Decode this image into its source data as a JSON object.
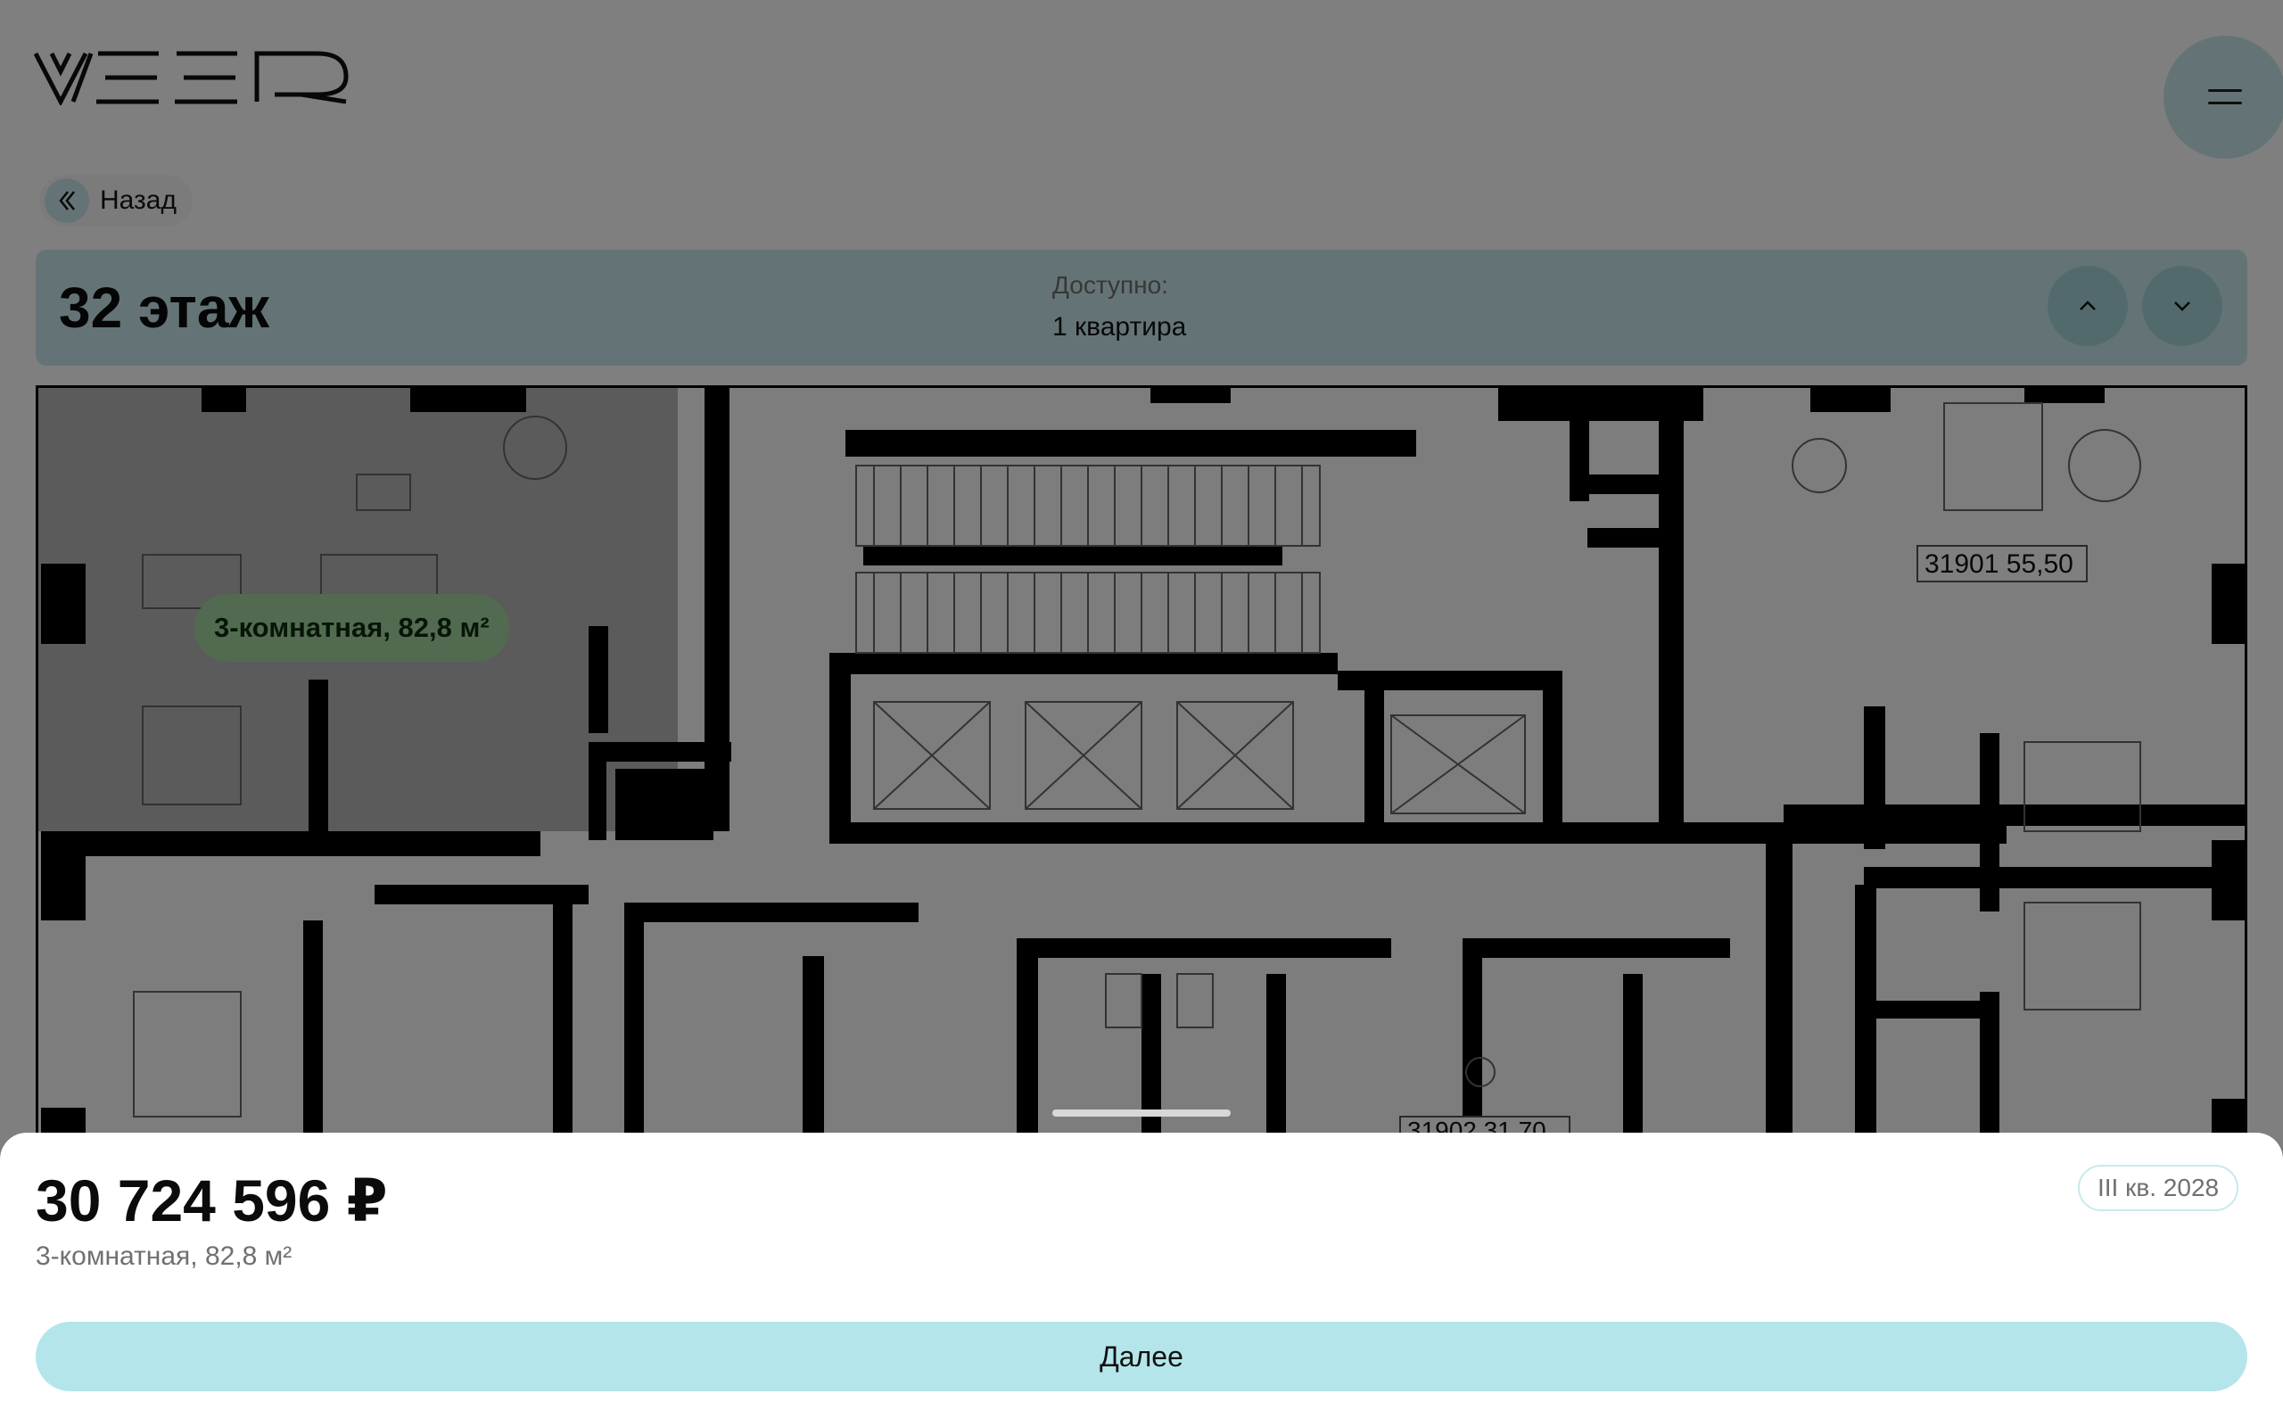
{
  "header": {
    "logo_text": "VEER",
    "menu_icon": "hamburger-icon"
  },
  "back": {
    "label": "Назад",
    "icon": "double-chevron-left-icon"
  },
  "floor": {
    "title": "32 этаж",
    "available_label": "Доступно:",
    "available_value": "1 квартира",
    "up_icon": "chevron-up-icon",
    "down_icon": "chevron-down-icon"
  },
  "plan": {
    "apt_badge": "3-комнатная, 82,8 м²",
    "labels": [
      {
        "number": "31901",
        "area": "55,50"
      },
      {
        "number": "31902",
        "area": "31,70"
      }
    ],
    "colors": {
      "selected_fill": "#b7b7b7",
      "walls": "#000000"
    }
  },
  "sheet": {
    "price": "30 724 596 ₽",
    "description": "3-комнатная, 82,8 м²",
    "date": "III кв. 2028",
    "next_label": "Далее"
  },
  "colors": {
    "accent": "#b4e5ea",
    "accent_light": "#c8e9ec",
    "badge_green": "#a5d6a1"
  }
}
